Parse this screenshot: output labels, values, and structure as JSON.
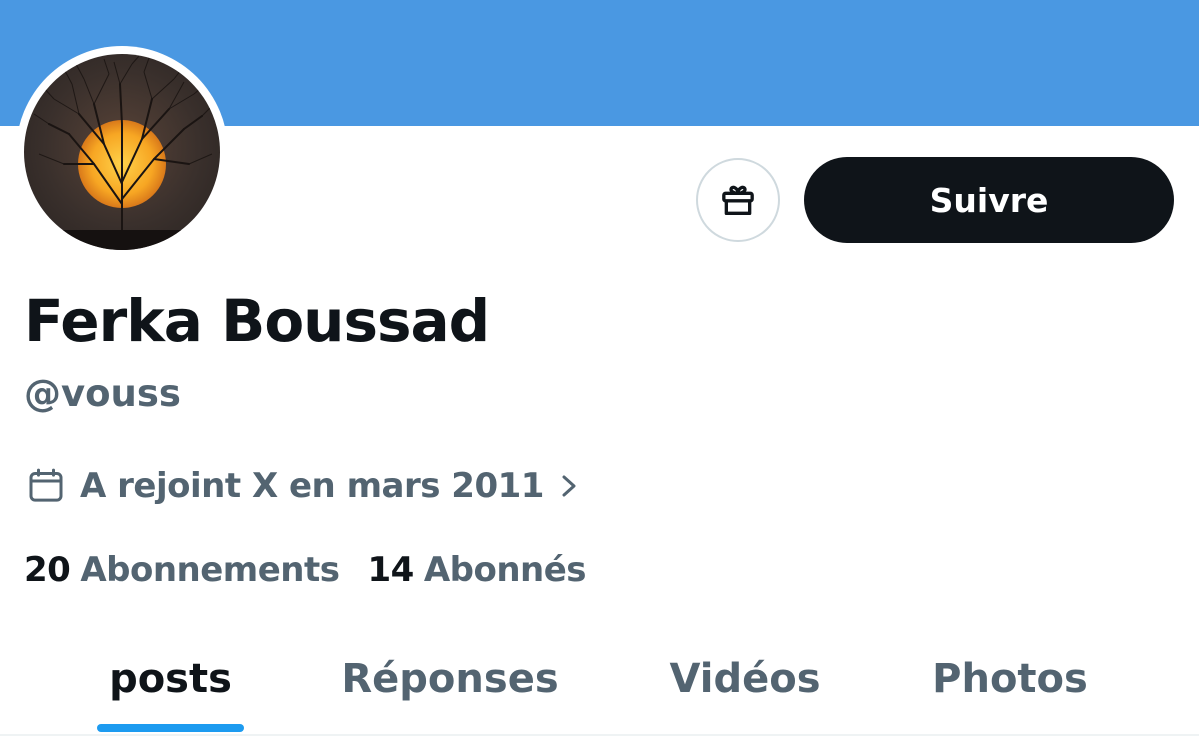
{
  "colors": {
    "banner": "#4a98e2",
    "accent": "#1d9bf0",
    "text_primary": "#0f1419",
    "text_secondary": "#536471",
    "follow_button_bg": "#0f1419"
  },
  "profile": {
    "display_name": "Ferka Boussad",
    "handle": "@vouss",
    "joined": "A rejoint X en mars 2011",
    "avatar_icon": "tree-sunset-avatar"
  },
  "actions": {
    "gift_icon": "gift-icon",
    "follow_label": "Suivre"
  },
  "stats": {
    "following_count": "20",
    "following_label": "Abonnements",
    "followers_count": "14",
    "followers_label": "Abonnés"
  },
  "tabs": [
    {
      "label": "posts",
      "active": true
    },
    {
      "label": "Réponses",
      "active": false
    },
    {
      "label": "Vidéos",
      "active": false
    },
    {
      "label": "Photos",
      "active": false
    }
  ]
}
